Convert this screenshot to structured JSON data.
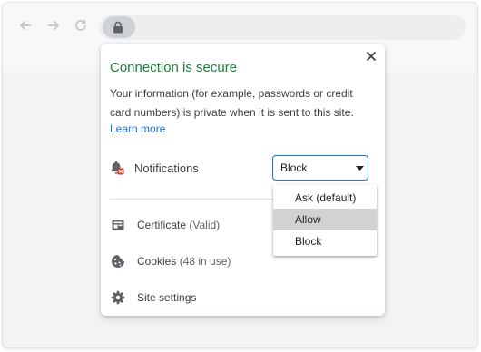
{
  "popup": {
    "title": "Connection is secure",
    "description": "Your information (for example, passwords or credit card numbers) is private when it is sent to this site.",
    "learn_more": "Learn more",
    "close_icon": "close-icon"
  },
  "permissions": {
    "notifications": {
      "label": "Notifications",
      "value": "Block"
    }
  },
  "rows": {
    "certificate": {
      "label": "Certificate",
      "sub": "(Valid)"
    },
    "cookies": {
      "label": "Cookies",
      "sub": "(48 in use)"
    },
    "site_settings": {
      "label": "Site settings"
    }
  },
  "dropdown": {
    "options": [
      "Ask (default)",
      "Allow",
      "Block"
    ],
    "highlighted": "Allow"
  },
  "colors": {
    "secure_green": "#188038",
    "link_blue": "#1a73e8",
    "blocked_red": "#d93025"
  },
  "icons": [
    "back-arrow-icon",
    "forward-arrow-icon",
    "reload-icon",
    "lock-icon",
    "bell-blocked-icon",
    "certificate-icon",
    "cookie-icon",
    "gear-icon",
    "chevron-down-icon"
  ]
}
